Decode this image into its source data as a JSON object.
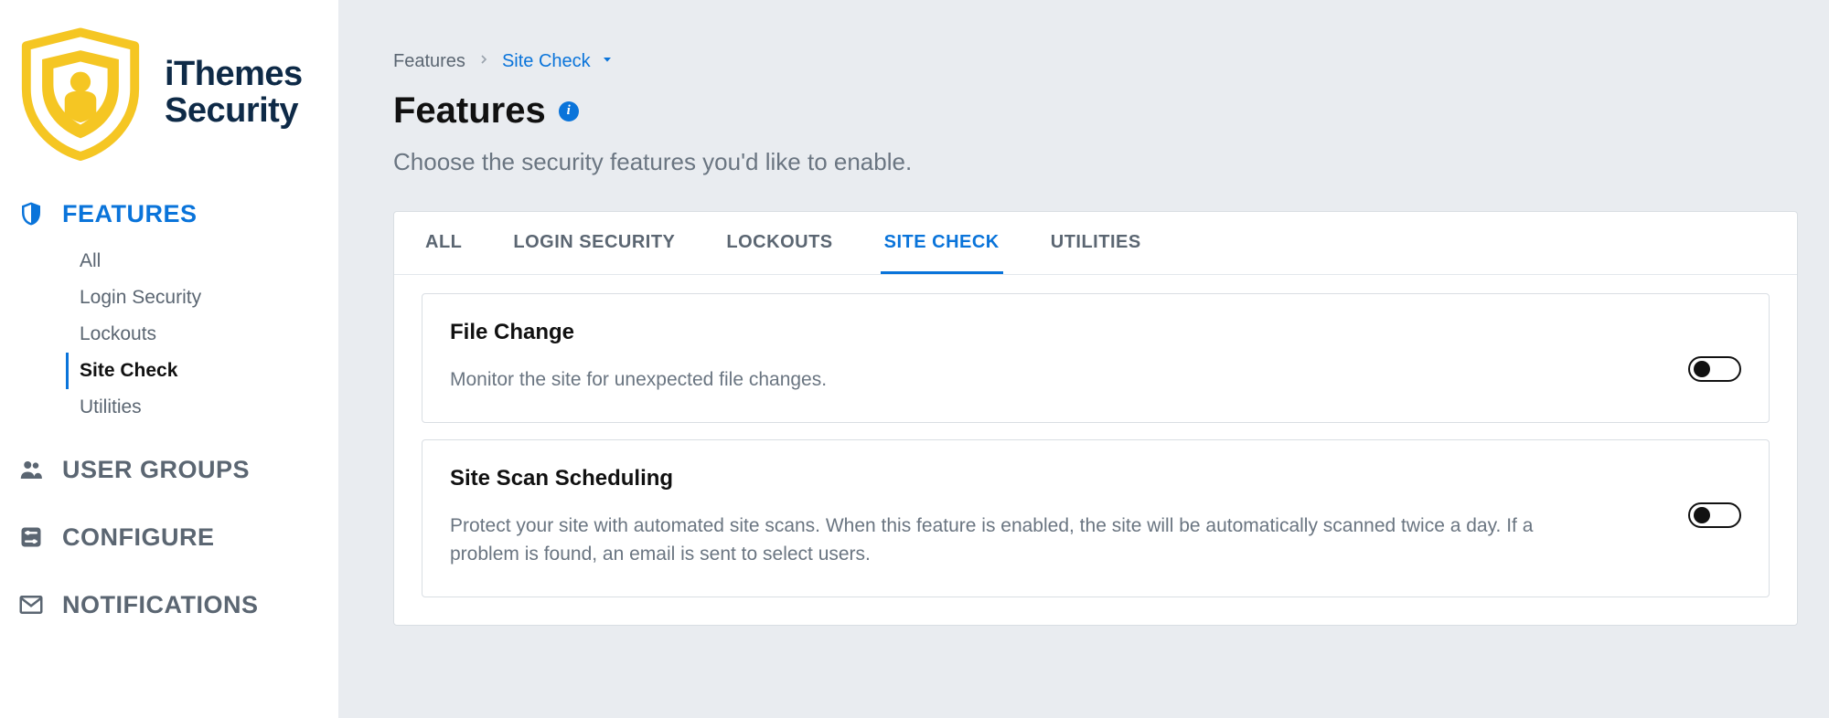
{
  "brand": {
    "line1": "iThemes",
    "line2": "Security"
  },
  "sidebar": {
    "sections": [
      {
        "label": "FEATURES",
        "items": [
          {
            "label": "All"
          },
          {
            "label": "Login Security"
          },
          {
            "label": "Lockouts"
          },
          {
            "label": "Site Check"
          },
          {
            "label": "Utilities"
          }
        ]
      },
      {
        "label": "USER GROUPS"
      },
      {
        "label": "CONFIGURE"
      },
      {
        "label": "NOTIFICATIONS"
      }
    ]
  },
  "breadcrumb": {
    "root": "Features",
    "leaf": "Site Check"
  },
  "page": {
    "title": "Features",
    "description": "Choose the security features you'd like to enable."
  },
  "tabs": [
    {
      "label": "ALL"
    },
    {
      "label": "LOGIN SECURITY"
    },
    {
      "label": "LOCKOUTS"
    },
    {
      "label": "SITE CHECK"
    },
    {
      "label": "UTILITIES"
    }
  ],
  "cards": [
    {
      "title": "File Change",
      "description": "Monitor the site for unexpected file changes.",
      "enabled": false
    },
    {
      "title": "Site Scan Scheduling",
      "description": "Protect your site with automated site scans. When this feature is enabled, the site will be automatically scanned twice a day. If a problem is found, an email is sent to select users.",
      "enabled": false
    }
  ]
}
